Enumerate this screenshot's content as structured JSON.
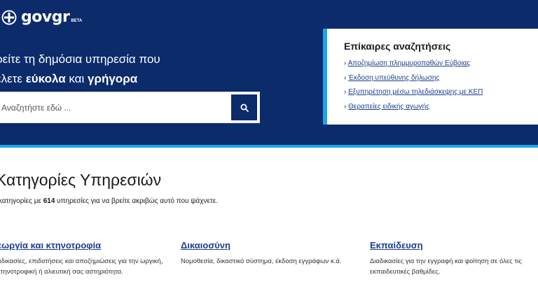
{
  "header": {
    "brand": "govgr",
    "beta": "BETA"
  },
  "hero": {
    "tagline_line1": "ρείτε τη δημόσια υπηρεσία που",
    "tagline_line2_prefix": "έλετε ",
    "tagline_bold1": "εύκολα",
    "tagline_mid": " και ",
    "tagline_bold2": "γρήγορα",
    "search_placeholder": "Αναζητήστε εδώ ..."
  },
  "trending": {
    "title": "Επίκαιρες αναζητήσεις",
    "items": [
      {
        "label": "Αποζημίωση πλημμυροπαθών Εύβοιας"
      },
      {
        "label": "Έκδοση υπεύθυνης δήλωσης"
      },
      {
        "label": "Εξυπηρέτηση μέσω τηλεδιάσκεψης με ΚΕΠ"
      },
      {
        "label": "Θεραπείες ειδικής αγωγής"
      }
    ]
  },
  "categories_section": {
    "title": "Κατηγορίες Υπηρεσιών",
    "sub_prefix": " κατηγορίες με ",
    "sub_count": "614",
    "sub_suffix": " υπηρεσίες για να βρείτε ακριβώς αυτό που ψάχνετε.",
    "items": [
      {
        "title": "εωργία και κτηνοτροφία",
        "desc": "αδικασίες, επιδοτήσεις και αποζημιώσεις για την ωργική, κτηνοτροφική ή αλιευτική σας αστηριότητα."
      },
      {
        "title": "Δικαιοσύνη",
        "desc": "Νομοθεσία, δικαστικό σύστημα, έκδοση εγγράφων κ.ά."
      },
      {
        "title": "Εκπαίδευση",
        "desc": "Διαδικασίες για την εγγραφή και φοίτηση σε όλες τις εκπαιδευτικές βαθμίδες."
      }
    ]
  },
  "colors": {
    "navy": "#0b2b6b",
    "accent": "#1aa6e8",
    "link": "#1b3d8f"
  }
}
